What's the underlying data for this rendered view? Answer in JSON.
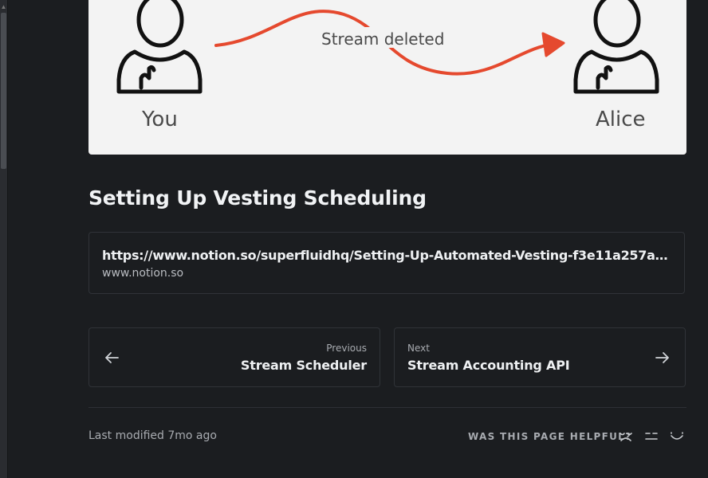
{
  "illustration": {
    "left_person": "You",
    "right_person": "Alice",
    "arrow_label": "Stream deleted",
    "arrow_color": "#e5492e"
  },
  "section": {
    "title": "Setting Up Vesting Scheduling"
  },
  "link_card": {
    "url": "https://www.notion.so/superfluidhq/Setting-Up-Automated-Vesting-f3e11a257a2d4b0b892...",
    "domain": "www.notion.so"
  },
  "pagination": {
    "previous": {
      "caption": "Previous",
      "title": "Stream Scheduler",
      "icon": "arrow-left-icon"
    },
    "next": {
      "caption": "Next",
      "title": "Stream Accounting API",
      "icon": "arrow-right-icon"
    }
  },
  "footer": {
    "last_modified": "Last modified 7mo ago",
    "helpful_prompt": "WAS THIS PAGE HELPFUL?",
    "feedback_icons": [
      "sad-face-icon",
      "neutral-face-icon",
      "happy-face-icon"
    ]
  },
  "colors": {
    "background": "#1b1d20",
    "card_border": "#303338",
    "illustration_bg": "#f3f3f3"
  }
}
